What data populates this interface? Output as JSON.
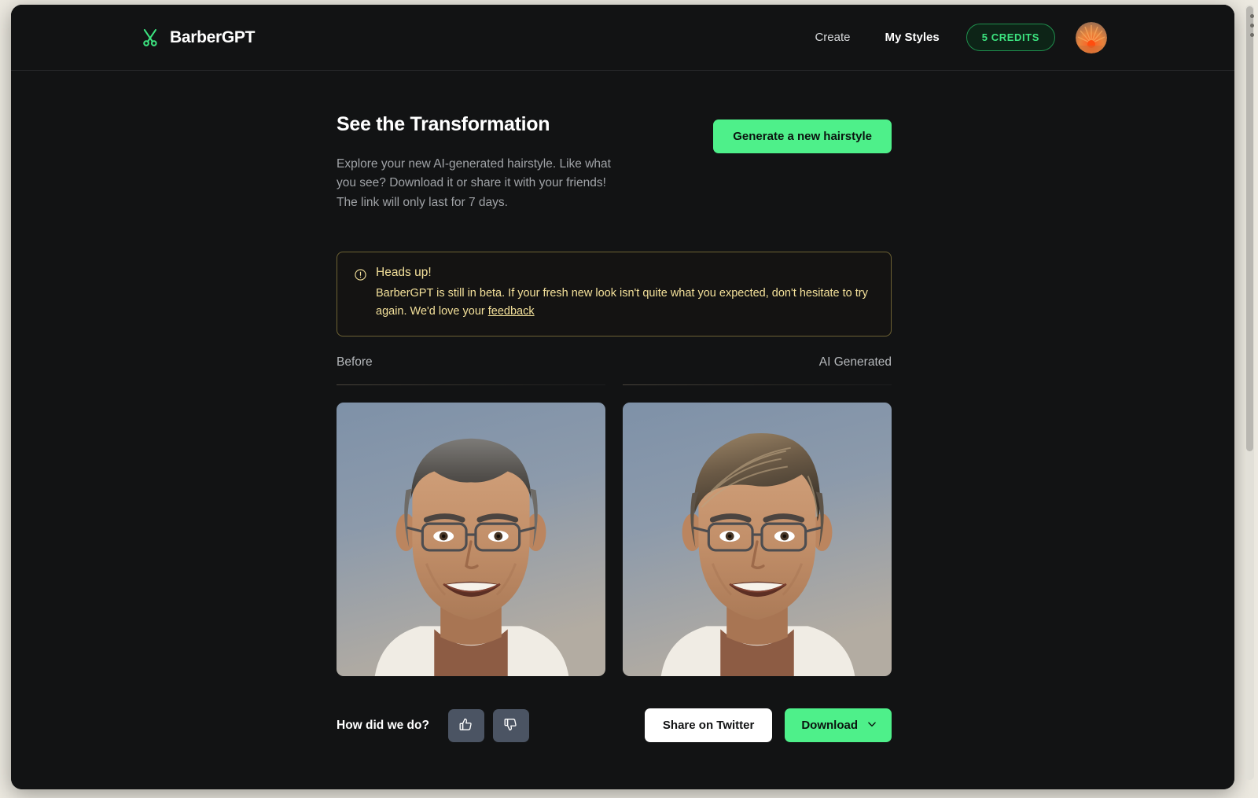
{
  "header": {
    "brand": "BarberGPT",
    "logo_icon": "scissors-icon",
    "nav": [
      {
        "label": "Create",
        "active": false
      },
      {
        "label": "My Styles",
        "active": true
      }
    ],
    "credits_label": "5 CREDITS",
    "avatar_icon": "avatar-sunburst"
  },
  "intro": {
    "title": "See the Transformation",
    "description": "Explore your new AI-generated hairstyle. Like what you see? Download it or share it with your friends! The link will only last for 7 days.",
    "generate_button": "Generate a new hairstyle"
  },
  "alert": {
    "icon": "exclamation-circle-icon",
    "title": "Heads up!",
    "body_before_link": "BarberGPT is still in beta. If your fresh new look isn't quite what you expected, don't hesitate to try again. We'd love your ",
    "link_label": "feedback"
  },
  "compare": {
    "before_label": "Before",
    "after_label": "AI Generated"
  },
  "actions": {
    "feedback_label": "How did we do?",
    "thumbs_up_icon": "thumbs-up-icon",
    "thumbs_down_icon": "thumbs-down-icon",
    "twitter_button": "Share on Twitter",
    "download_button": "Download",
    "download_chevron_icon": "chevron-down-icon"
  },
  "colors": {
    "accent_green": "#4ef08a",
    "credits_green": "#3ce37f",
    "alert_yellow": "#f3e09a",
    "page_bg": "#121314",
    "frame_bg": "#ece9e0"
  }
}
